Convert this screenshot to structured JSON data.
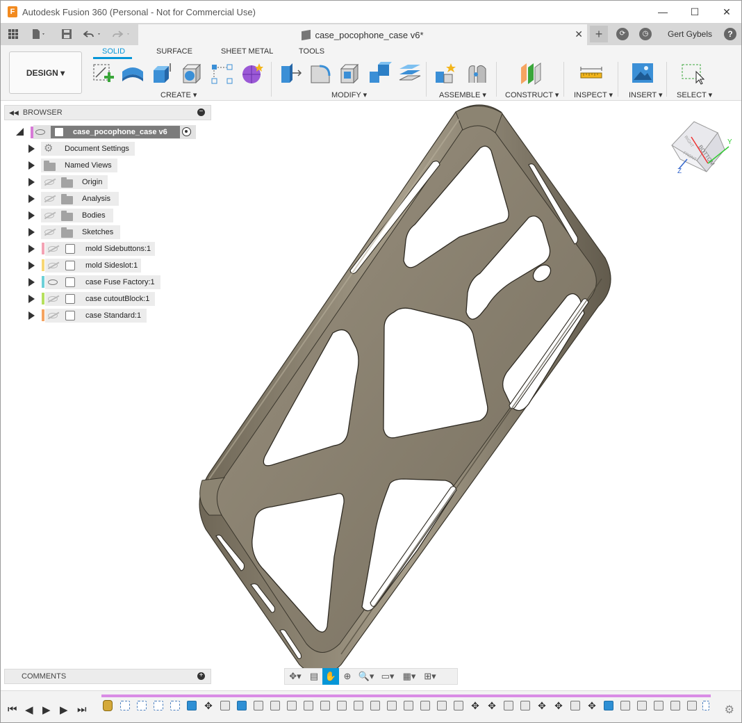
{
  "window": {
    "title": "Autodesk Fusion 360 (Personal - Not for Commercial Use)",
    "logo_letter": "F",
    "minimize": "—",
    "maximize": "☐",
    "close": "✕"
  },
  "tabbar": {
    "doc_title": "case_pocophone_case v6*",
    "close": "✕",
    "new_tab": "+",
    "user": "Gert Gybels",
    "help": "?"
  },
  "ribbon": {
    "mode_button": "DESIGN ▾",
    "workspace_tabs": [
      "SOLID",
      "SURFACE",
      "SHEET METAL",
      "TOOLS"
    ],
    "active_tab": "SOLID",
    "groups": [
      "CREATE ▾",
      "MODIFY ▾",
      "ASSEMBLE ▾",
      "CONSTRUCT ▾",
      "INSPECT ▾",
      "INSERT ▾",
      "SELECT ▾"
    ]
  },
  "browser": {
    "title": "BROWSER",
    "root": "case_pocophone_case v6",
    "items": [
      {
        "label": "Document Settings",
        "icon": "gear-icon"
      },
      {
        "label": "Named Views",
        "icon": "folder-icon"
      },
      {
        "label": "Origin",
        "icon": "folder-icon"
      },
      {
        "label": "Analysis",
        "icon": "folder-icon"
      },
      {
        "label": "Bodies",
        "icon": "folder-icon"
      },
      {
        "label": "Sketches",
        "icon": "folder-icon"
      },
      {
        "label": "mold Sidebuttons:1",
        "icon": "component-icon",
        "color": "#f4a3b4"
      },
      {
        "label": "mold Sideslot:1",
        "icon": "component-icon",
        "color": "#f7d774"
      },
      {
        "label": "case Fuse Factory:1",
        "icon": "component-icon",
        "color": "#6dd0d8"
      },
      {
        "label": "case cutoutBlock:1",
        "icon": "component-icon",
        "color": "#b6e05e"
      },
      {
        "label": "case Standard:1",
        "icon": "component-icon",
        "color": "#f5a461"
      }
    ]
  },
  "viewcube": {
    "face_label": "BOTTOM",
    "side_label": "RIGHT",
    "front_label": "FRONT"
  },
  "comments": {
    "title": "COMMENTS"
  },
  "colors": {
    "accent": "#0696d7",
    "model_body": "#8b8271",
    "model_edge": "#3a362c"
  }
}
